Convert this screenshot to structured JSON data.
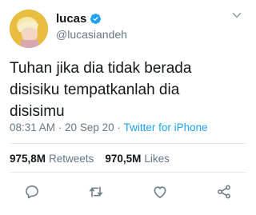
{
  "user": {
    "display_name": "lucas",
    "handle": "@lucasiandeh",
    "verified": true
  },
  "tweet": {
    "text": "Tuhan jika dia tidak berada\ndisisiku tempatkanlah dia\ndisisimu",
    "time": "08:31 AM",
    "separator": " · ",
    "date": "20 Sep 20",
    "separator2": " · ",
    "source": "Twitter for iPhone"
  },
  "stats": {
    "retweets_count": "975,8M",
    "retweets_label": "Retweets",
    "likes_count": "970,5M",
    "likes_label": "Likes"
  },
  "icons": {
    "reply": "reply-icon",
    "retweet": "retweet-icon",
    "like": "like-icon",
    "share": "share-icon",
    "more": "chevron-down-icon",
    "verified": "verified-badge-icon"
  },
  "colors": {
    "accent": "#1da1f2",
    "text": "#14171a",
    "muted": "#657786",
    "divider": "#e1e8ed"
  }
}
